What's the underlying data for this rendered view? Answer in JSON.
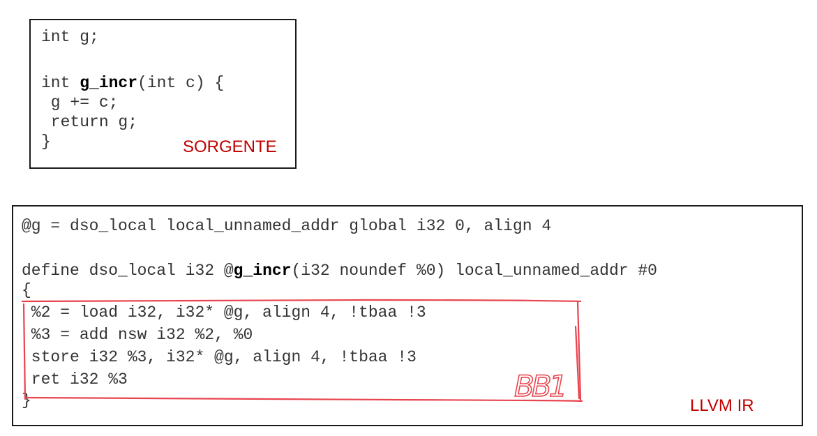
{
  "source": {
    "lines": [
      {
        "pre": "int g;",
        "bold": "",
        "post": ""
      },
      {
        "pre": "",
        "bold": "",
        "post": ""
      },
      {
        "pre": "int ",
        "bold": "g_incr",
        "post": "(int c) {"
      },
      {
        "pre": " g += c;",
        "bold": "",
        "post": ""
      },
      {
        "pre": " return g;",
        "bold": "",
        "post": ""
      },
      {
        "pre": "}",
        "bold": "",
        "post": ""
      }
    ],
    "tag": "SORGENTE"
  },
  "ir": {
    "lines": [
      {
        "pre": "@g = dso_local local_unnamed_addr global i32 0, align 4",
        "bold": "",
        "post": ""
      },
      {
        "pre": "",
        "bold": "",
        "post": ""
      },
      {
        "pre": "define dso_local i32 @",
        "bold": "g_incr",
        "post": "(i32 noundef %0) local_unnamed_addr #0"
      },
      {
        "pre": "{",
        "bold": "",
        "post": ""
      },
      {
        "pre": " %2 = load i32, i32* @g, align 4, !tbaa !3",
        "bold": "",
        "post": ""
      },
      {
        "pre": " %3 = add nsw i32 %2, %0",
        "bold": "",
        "post": ""
      },
      {
        "pre": " store i32 %3, i32* @g, align 4, !tbaa !3",
        "bold": "",
        "post": ""
      },
      {
        "pre": " ret i32 %3",
        "bold": "",
        "post": ""
      },
      {
        "pre": "}",
        "bold": "",
        "post": ""
      }
    ],
    "tag": "LLVM IR"
  },
  "annotation": {
    "label": "BB1",
    "color": "#e8444e"
  }
}
